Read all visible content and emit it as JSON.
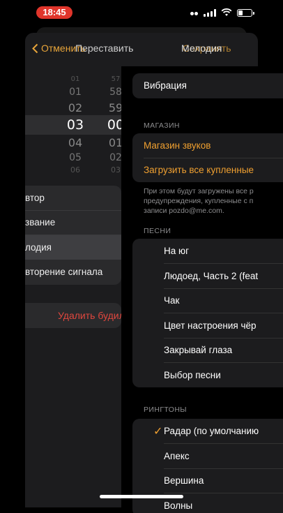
{
  "status_bar": {
    "time": "18:45",
    "battery_level": 0.35
  },
  "alarm_edit": {
    "cancel": "Отменить",
    "title": "Перес",
    "title_suffix": "тавить",
    "save": "Сохранить",
    "hours": [
      "01",
      "02",
      "03",
      "04",
      "05",
      "06"
    ],
    "selected_hour": "03",
    "minutes": [
      "57",
      "58",
      "59",
      "00",
      "01",
      "02",
      "03"
    ],
    "selected_minute": "00",
    "settings": [
      {
        "label": "втор"
      },
      {
        "label": "звание"
      },
      {
        "label": "лодия"
      },
      {
        "label": "вторение сигнала"
      }
    ],
    "delete": "Удалить будильник"
  },
  "melody": {
    "title": "Мелодия",
    "vibration": "Вибрация",
    "store_header": "МАГАЗИН",
    "tone_store": "Магазин звуков",
    "download_all": "Загрузить все купленные",
    "download_note": [
      "При этом будут загружены все р",
      "предупреждения, купленные с п",
      "записи pozdo@me.com."
    ],
    "songs_header": "ПЕСНИ",
    "songs": [
      "На юг",
      "Людоед, Часть 2 (feat",
      "Чак",
      "Цвет настроения чёр",
      "Закрывай глаза",
      "Выбор песни"
    ],
    "ringtones_header": "РИНГТОНЫ",
    "ringtones": [
      "Радар (по умолчанию",
      "Апекс",
      "Вершина",
      "Волны"
    ],
    "selected_ringtone": "Радар (по умолчанию"
  },
  "colors": {
    "accent": "#f0a030",
    "destructive": "#e0473e",
    "status_pill": "#e0352b"
  }
}
